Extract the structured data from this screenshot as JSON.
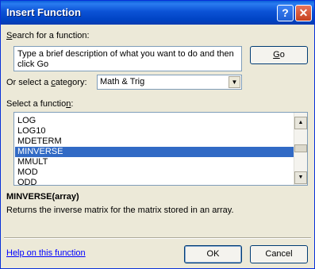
{
  "window": {
    "title": "Insert Function",
    "help_glyph": "?",
    "close_glyph": "✕"
  },
  "search": {
    "label_accel": "S",
    "label_rest": "earch for a function:",
    "value": "Type a brief description of what you want to do and then click Go",
    "go_accel": "G",
    "go_rest": "o"
  },
  "category": {
    "label_pre": "Or select a ",
    "label_accel": "c",
    "label_post": "ategory:",
    "selected": "Math & Trig",
    "arrow_glyph": "▼"
  },
  "functions": {
    "label_pre": "Select a functio",
    "label_accel": "n",
    "label_post": ":",
    "items": [
      "LOG",
      "LOG10",
      "MDETERM",
      "MINVERSE",
      "MMULT",
      "MOD",
      "ODD"
    ],
    "selected": "MINVERSE",
    "scroll_up_glyph": "▲",
    "scroll_down_glyph": "▼"
  },
  "description": {
    "signature": "MINVERSE(array)",
    "text": "Returns the inverse matrix for the matrix stored in an array."
  },
  "footer": {
    "help_link": "Help on this function",
    "ok_label": "OK",
    "cancel_label": "Cancel"
  },
  "colors": {
    "titlebar": "#0b52d6",
    "selection": "#316ac5",
    "dialog_bg": "#ece9d8",
    "link": "#0000ff"
  }
}
